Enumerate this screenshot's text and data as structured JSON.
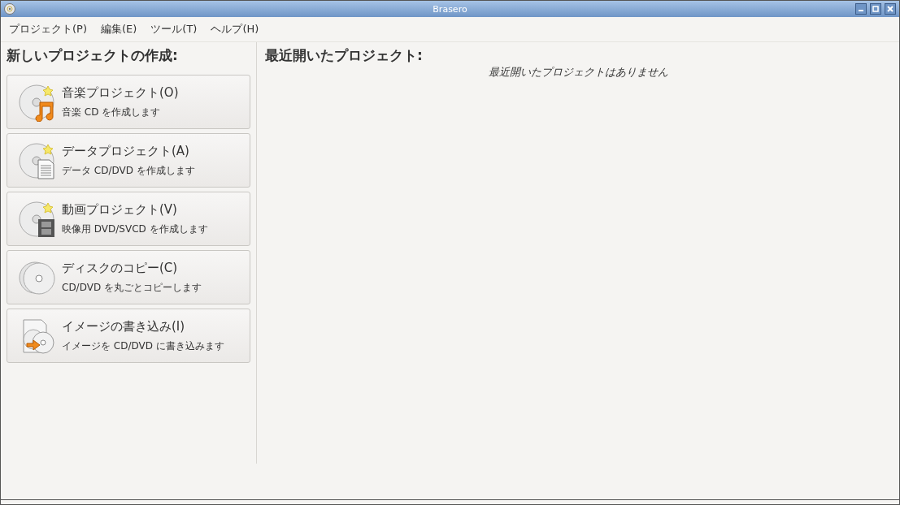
{
  "window": {
    "title": "Brasero"
  },
  "menu": [
    {
      "label": "プロジェクト(P)"
    },
    {
      "label": "編集(E)"
    },
    {
      "label": "ツール(T)"
    },
    {
      "label": "ヘルプ(H)"
    }
  ],
  "new_project": {
    "heading": "新しいプロジェクトの作成:",
    "buttons": [
      {
        "kind": "audio",
        "title": "音楽プロジェクト(O)",
        "description": "音楽 CD を作成します"
      },
      {
        "kind": "data",
        "title": "データプロジェクト(A)",
        "description": "データ CD/DVD を作成します"
      },
      {
        "kind": "video",
        "title": "動画プロジェクト(V)",
        "description": "映像用 DVD/SVCD を作成します"
      },
      {
        "kind": "copy",
        "title": "ディスクのコピー(C)",
        "description": "CD/DVD を丸ごとコピーします"
      },
      {
        "kind": "image",
        "title": "イメージの書き込み(I)",
        "description": "イメージを CD/DVD に書き込みます"
      }
    ]
  },
  "recent": {
    "heading": "最近開いたプロジェクト:",
    "empty_message": "最近開いたプロジェクトはありません"
  }
}
